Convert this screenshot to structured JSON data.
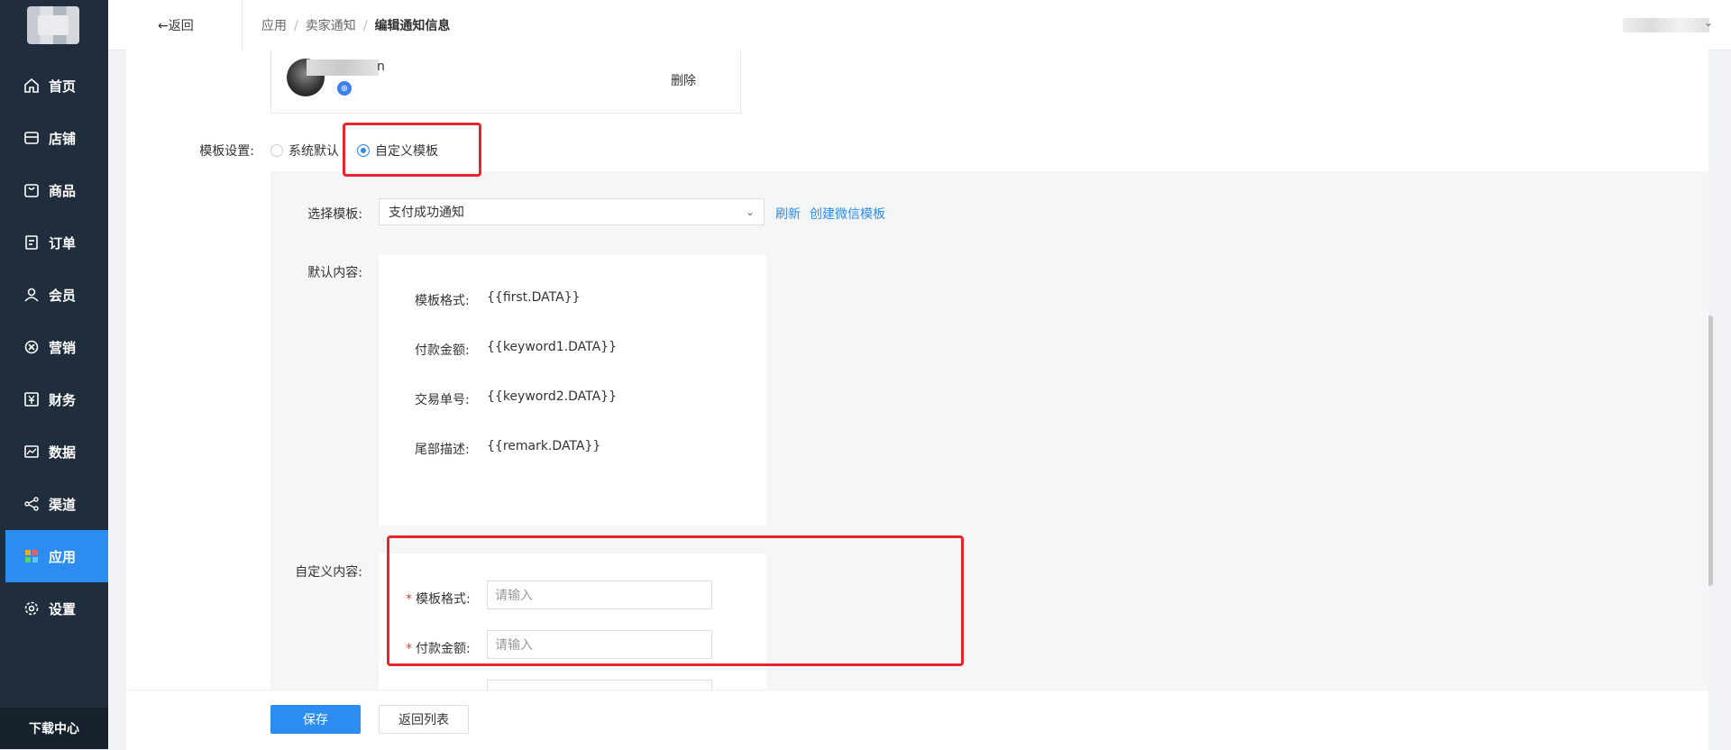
{
  "sidebar": {
    "items": [
      {
        "label": "首页",
        "icon": "home-icon"
      },
      {
        "label": "店铺",
        "icon": "store-icon"
      },
      {
        "label": "商品",
        "icon": "bag-icon"
      },
      {
        "label": "订单",
        "icon": "order-icon"
      },
      {
        "label": "会员",
        "icon": "user-icon"
      },
      {
        "label": "营销",
        "icon": "marketing-icon"
      },
      {
        "label": "财务",
        "icon": "yen-icon"
      },
      {
        "label": "数据",
        "icon": "chart-icon"
      },
      {
        "label": "渠道",
        "icon": "share-icon"
      },
      {
        "label": "应用",
        "icon": "apps-icon",
        "active": true
      },
      {
        "label": "设置",
        "icon": "gear-icon"
      }
    ],
    "download": "下载中心",
    "active_color": "#2d8cf0"
  },
  "header": {
    "back": "←返回",
    "breadcrumb": [
      "应用",
      "卖家通知",
      "编辑通知信息"
    ]
  },
  "recipient": {
    "name_tail": "n",
    "delete": "删除"
  },
  "template_setting": {
    "label": "模板设置:",
    "options": [
      "系统默认",
      "自定义模板"
    ],
    "selected": "自定义模板"
  },
  "select_template": {
    "label": "选择模板:",
    "value": "支付成功通知",
    "refresh": "刷新",
    "create": "创建微信模板"
  },
  "default_content": {
    "label": "默认内容:",
    "rows": [
      {
        "label": "模板格式:",
        "value": "{{first.DATA}}"
      },
      {
        "label": "付款金额:",
        "value": "{{keyword1.DATA}}"
      },
      {
        "label": "交易单号:",
        "value": "{{keyword2.DATA}}"
      },
      {
        "label": "尾部描述:",
        "value": "{{remark.DATA}}"
      }
    ]
  },
  "custom_content": {
    "label": "自定义内容:",
    "fields": [
      {
        "label": "模板格式:",
        "placeholder": "请输入"
      },
      {
        "label": "付款金额:",
        "placeholder": "请输入"
      }
    ]
  },
  "footer": {
    "save": "保存",
    "back_list": "返回列表"
  },
  "highlight_color": "#e8252c"
}
